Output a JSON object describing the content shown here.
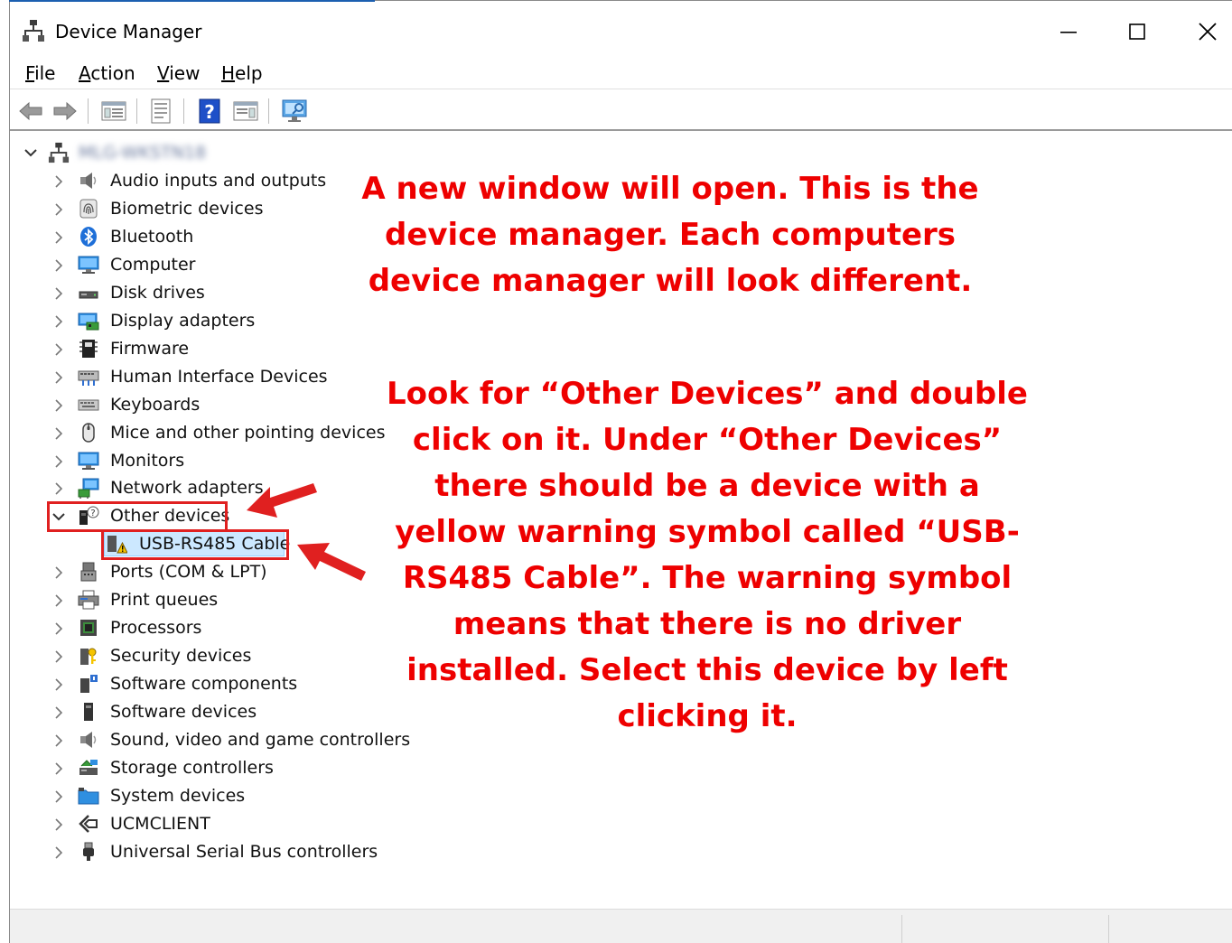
{
  "window": {
    "title": "Device Manager",
    "controls": {
      "minimize": "—",
      "maximize": "☐",
      "close": "✕"
    }
  },
  "menu": [
    {
      "label": "File",
      "accel": "F",
      "rest": "ile"
    },
    {
      "label": "Action",
      "accel": "A",
      "rest": "ction"
    },
    {
      "label": "View",
      "accel": "V",
      "rest": "iew"
    },
    {
      "label": "Help",
      "accel": "H",
      "rest": "elp"
    }
  ],
  "toolbar": {
    "buttons": [
      "back-arrow-icon",
      "forward-arrow-icon",
      "show-hide-tree-icon",
      "properties-icon",
      "help-icon",
      "action-pane-icon",
      "monitor-scan-icon"
    ]
  },
  "tree": {
    "root": "MLG-WKSTN18",
    "categories": [
      {
        "label": "Audio inputs and outputs",
        "icon": "speaker-icon"
      },
      {
        "label": "Biometric devices",
        "icon": "fingerprint-icon"
      },
      {
        "label": "Bluetooth",
        "icon": "bluetooth-icon"
      },
      {
        "label": "Computer",
        "icon": "computer-icon"
      },
      {
        "label": "Disk drives",
        "icon": "disk-drive-icon"
      },
      {
        "label": "Display adapters",
        "icon": "display-adapter-icon"
      },
      {
        "label": "Firmware",
        "icon": "firmware-chip-icon"
      },
      {
        "label": "Human Interface Devices",
        "icon": "hid-icon"
      },
      {
        "label": "Keyboards",
        "icon": "keyboard-icon"
      },
      {
        "label": "Mice and other pointing devices",
        "icon": "mouse-icon"
      },
      {
        "label": "Monitors",
        "icon": "monitor-icon"
      },
      {
        "label": "Network adapters",
        "icon": "network-adapter-icon"
      },
      {
        "label": "Other devices",
        "icon": "unknown-device-icon",
        "expanded": true
      },
      {
        "label": "USB-RS485 Cable",
        "icon": "warning-device-icon",
        "child": true,
        "selected": true
      },
      {
        "label": "Ports (COM & LPT)",
        "icon": "port-icon"
      },
      {
        "label": "Print queues",
        "icon": "printer-icon"
      },
      {
        "label": "Processors",
        "icon": "processor-icon"
      },
      {
        "label": "Security devices",
        "icon": "security-key-icon"
      },
      {
        "label": "Software components",
        "icon": "software-component-icon"
      },
      {
        "label": "Software devices",
        "icon": "software-device-icon"
      },
      {
        "label": "Sound, video and game controllers",
        "icon": "speaker-icon"
      },
      {
        "label": "Storage controllers",
        "icon": "storage-controller-icon"
      },
      {
        "label": "System devices",
        "icon": "system-folder-icon"
      },
      {
        "label": "UCMCLIENT",
        "icon": "ucm-client-icon"
      },
      {
        "label": "Universal Serial Bus controllers",
        "icon": "usb-plug-icon"
      }
    ]
  },
  "annotations": {
    "note1": [
      "A new window will open. This is the",
      "device manager. Each computers",
      "device manager will look different."
    ],
    "note2": [
      "Look for “Other Devices” and double",
      "click on it. Under “Other Devices”",
      "there should be a device with a",
      "yellow warning symbol called “USB-",
      "RS485 Cable”. The warning symbol",
      "means that there is no driver",
      "installed. Select this device by left",
      "clicking it."
    ],
    "color": "#ee0000"
  }
}
